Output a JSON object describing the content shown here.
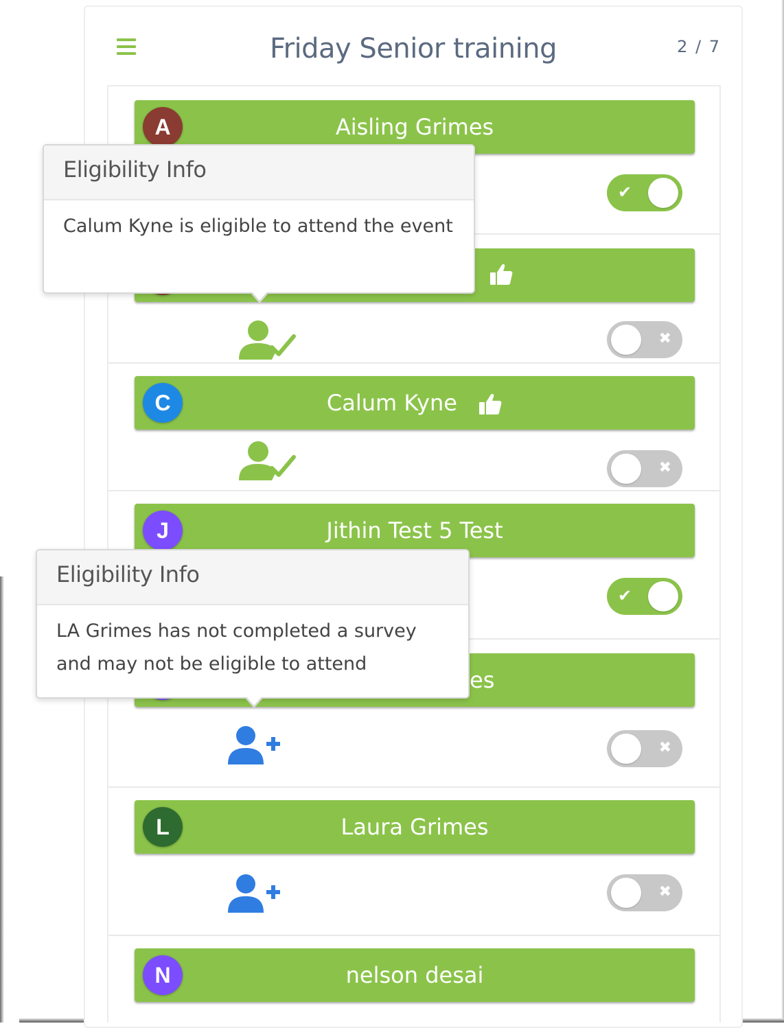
{
  "header": {
    "title": "Friday Senior training",
    "page_count": "2 / 7",
    "menu_icon": "hamburger-menu-icon"
  },
  "colors": {
    "bar_green": "#8bc34a",
    "toggle_off": "#c8c8c8",
    "eligible_icon": "#8bc34a",
    "add_icon": "#2f7de1",
    "title_text": "#5b6a80"
  },
  "members": [
    {
      "initial": "A",
      "name": "Aisling Grimes",
      "avatar_color": "#8a3b32",
      "thumbs_up": false,
      "status_icon": "none",
      "attending": true
    },
    {
      "initial": "",
      "name": "",
      "avatar_color": "#8a3b32",
      "thumbs_up": true,
      "status_icon": "user-check-icon",
      "attending": false
    },
    {
      "initial": "C",
      "name": "Calum Kyne",
      "avatar_color": "#1e88e5",
      "thumbs_up": true,
      "status_icon": "user-check-icon",
      "attending": false
    },
    {
      "initial": "J",
      "name": "Jithin Test 5 Test",
      "avatar_color": "#7c4dff",
      "thumbs_up": false,
      "status_icon": "none",
      "attending": true
    },
    {
      "initial": "",
      "name": "es",
      "avatar_color": "#7c4dff",
      "thumbs_up": false,
      "status_icon": "user-plus-icon",
      "attending": false
    },
    {
      "initial": "L",
      "name": "Laura Grimes",
      "avatar_color": "#2e6b30",
      "thumbs_up": false,
      "status_icon": "user-plus-icon",
      "attending": false
    },
    {
      "initial": "N",
      "name": "nelson desai",
      "avatar_color": "#7c4dff",
      "thumbs_up": false,
      "status_icon": "none",
      "attending": false
    }
  ],
  "toggle": {
    "on_mark": "✔",
    "off_mark": "✖"
  },
  "tooltips": [
    {
      "title": "Eligibility Info",
      "body": "Calum Kyne is eligible to attend the event"
    },
    {
      "title": "Eligibility Info",
      "body": "LA Grimes has not completed a survey and may not be eligible to attend"
    }
  ]
}
